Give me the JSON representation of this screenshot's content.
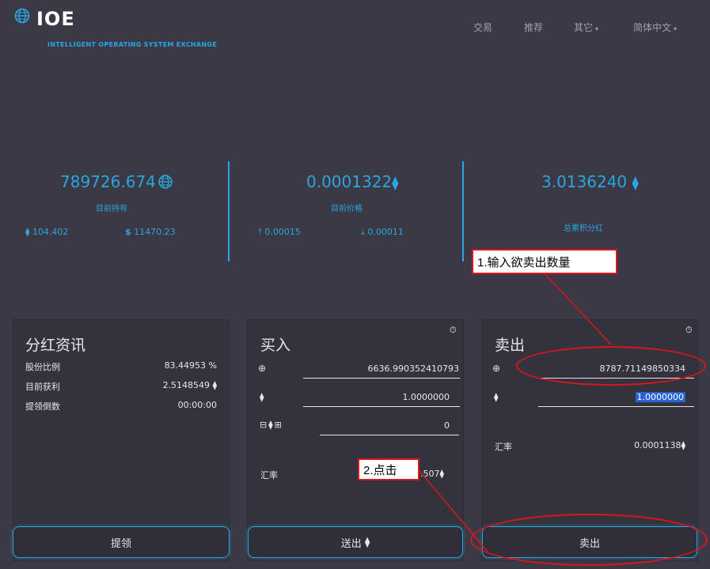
{
  "header": {
    "logo": "IOE",
    "subtitle": "INTELLIGENT OPERATING SYSTEM EXCHANGE",
    "nav": {
      "trade": "交易",
      "recommend": "推荐",
      "other": "其它",
      "language": "简体中文"
    }
  },
  "stats": {
    "holding": {
      "value": "789726.674",
      "label": "目前持有",
      "eth": "104.402",
      "usd": "11470.23"
    },
    "price": {
      "value": "0.0001322",
      "label": "目前价格",
      "up": "0.00015",
      "down": "0.00011"
    },
    "dividend": {
      "value": "3.0136240",
      "label": "总累积分红"
    }
  },
  "dividend_panel": {
    "title": "分红资讯",
    "rows": [
      {
        "label": "股份比例",
        "value": "83.44953 %"
      },
      {
        "label": "目前获利",
        "value": "2.5148549"
      },
      {
        "label": "提领倒数",
        "value": "00:00:00"
      }
    ],
    "button": "提领"
  },
  "buy_panel": {
    "title": "买入",
    "token_amount": "6636.990352410793",
    "eth_amount": "1.0000000",
    "extra_amount": "0",
    "rate_label": "汇率",
    "rate_partial": ".507",
    "button": "送出"
  },
  "sell_panel": {
    "title": "卖出",
    "token_amount": "8787.71149850334",
    "eth_amount": "1.0000000",
    "rate_label": "汇率",
    "rate_value": "0.0001138",
    "button": "卖出"
  },
  "annotations": {
    "step1": "1.输入欲卖出数量",
    "step2": "2.点击"
  },
  "colors": {
    "background": "#3a3945",
    "accent": "#2aa6e0",
    "annotation": "#d9161c"
  }
}
